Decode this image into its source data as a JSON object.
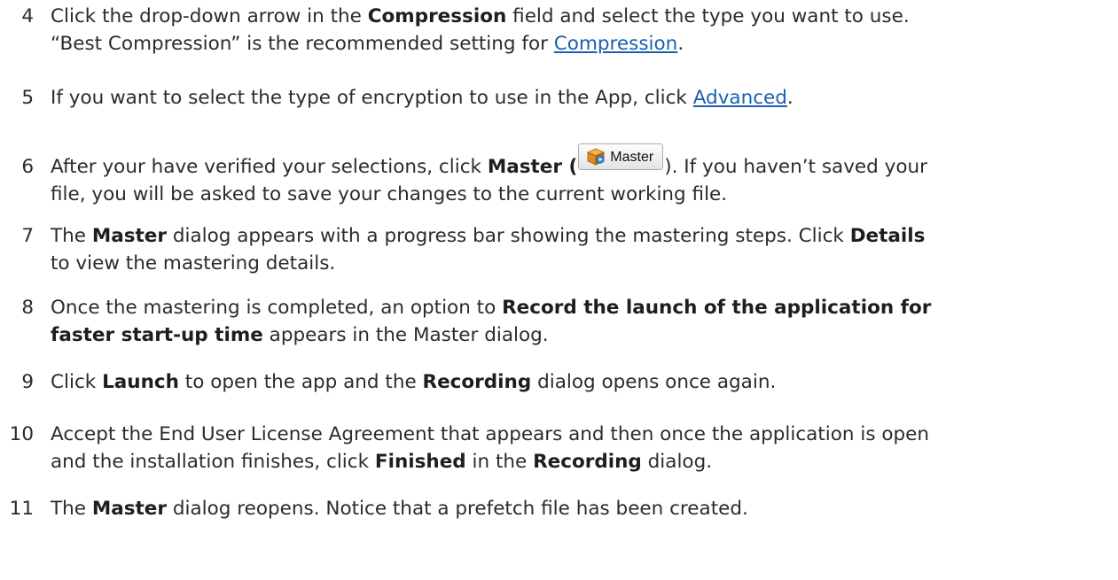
{
  "steps": [
    {
      "num": "4",
      "p1": "Click the drop-down arrow in the ",
      "b1": "Compression",
      "p2": " field and select the type you want to use.",
      "l2a": "“Best Compression” is the recommended setting for ",
      "link": "Compression",
      "l2b": "."
    },
    {
      "num": "5",
      "p1": "If you want to select the type of encryption to use in the App, click ",
      "link": "Advanced",
      "p2": "."
    },
    {
      "num": "6",
      "p1": "After your have verified your selections, click ",
      "b1": "Master (",
      "button_label": "Master",
      "button_icon": "master-package-icon",
      "p2": "). If you haven’t saved your",
      "l2": "file, you will be asked to save your changes to the current working file."
    },
    {
      "num": "7",
      "p1": "The ",
      "b1": "Master",
      "p2": " dialog appears with a progress bar showing the mastering steps. Click ",
      "b2": "Details",
      "l2": "to view the mastering details."
    },
    {
      "num": "8",
      "p1": "Once the mastering is completed, an option to ",
      "b1": "Record the launch of the application for",
      "l2b": "faster start-up time",
      "l2": " appears in the Master dialog."
    },
    {
      "num": "9",
      "p1": "Click ",
      "b1": "Launch",
      "p2": " to open the app and the ",
      "b2": "Recording",
      "p3": " dialog opens once again."
    },
    {
      "num": "10",
      "p1": "Accept the End User License Agreement that appears and then once the application is open",
      "l2a": "and the installation finishes, click ",
      "b1": "Finished",
      "l2b": " in the ",
      "b2": "Recording",
      "l2c": " dialog."
    },
    {
      "num": "11",
      "p1": "The ",
      "b1": "Master",
      "p2": " dialog reopens. Notice that a prefetch file has been created."
    }
  ],
  "colors": {
    "text": "#2b2b2b",
    "link": "#1a5fb4"
  }
}
